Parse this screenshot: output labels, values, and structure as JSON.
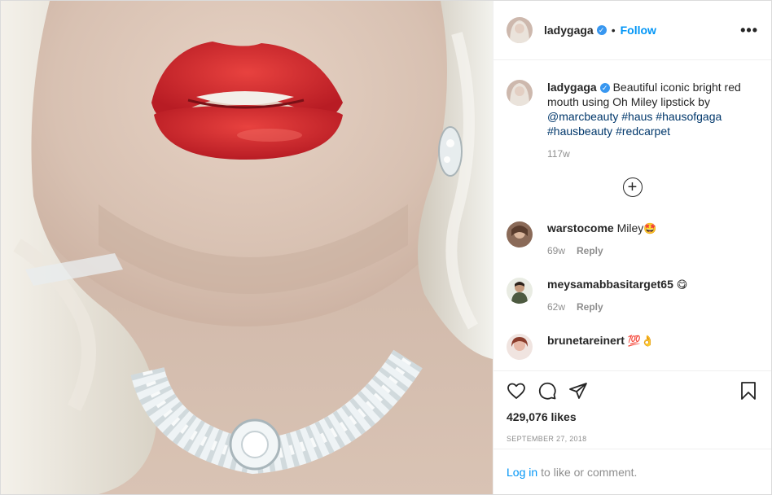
{
  "header": {
    "username": "ladygaga",
    "separator": "•",
    "follow_label": "Follow",
    "more_label": "•••"
  },
  "caption": {
    "username": "ladygaga",
    "text_before": "Beautiful iconic bright red mouth using Oh Miley lipstick by ",
    "mention": "@marcbeauty",
    "tags": [
      "#haus",
      "#hausofgaga",
      "#hausbeauty",
      "#redcarpet"
    ],
    "age": "117w"
  },
  "load_more_label": "+",
  "comments": [
    {
      "username": "warstocome",
      "text": "Miley",
      "emoji": "🤩",
      "age": "69w",
      "reply_label": "Reply"
    },
    {
      "username": "meysamabbasitarget65",
      "text": "",
      "emoji": "😋",
      "age": "62w",
      "reply_label": "Reply"
    },
    {
      "username": "brunetareinert",
      "text": "",
      "emoji": "💯👌",
      "age": "",
      "reply_label": ""
    }
  ],
  "likes": "429,076 likes",
  "date": "September 27, 2018",
  "login": {
    "link_label": "Log in",
    "text": "to like or comment."
  },
  "icons": [
    "heart-icon",
    "comment-icon",
    "share-icon",
    "bookmark-icon",
    "verified-badge-icon"
  ],
  "colors": {
    "accent": "#0095f6",
    "verified": "#3897f0",
    "hashtag": "#00376b",
    "muted": "#8e8e8e",
    "lips": "#d4262c"
  }
}
